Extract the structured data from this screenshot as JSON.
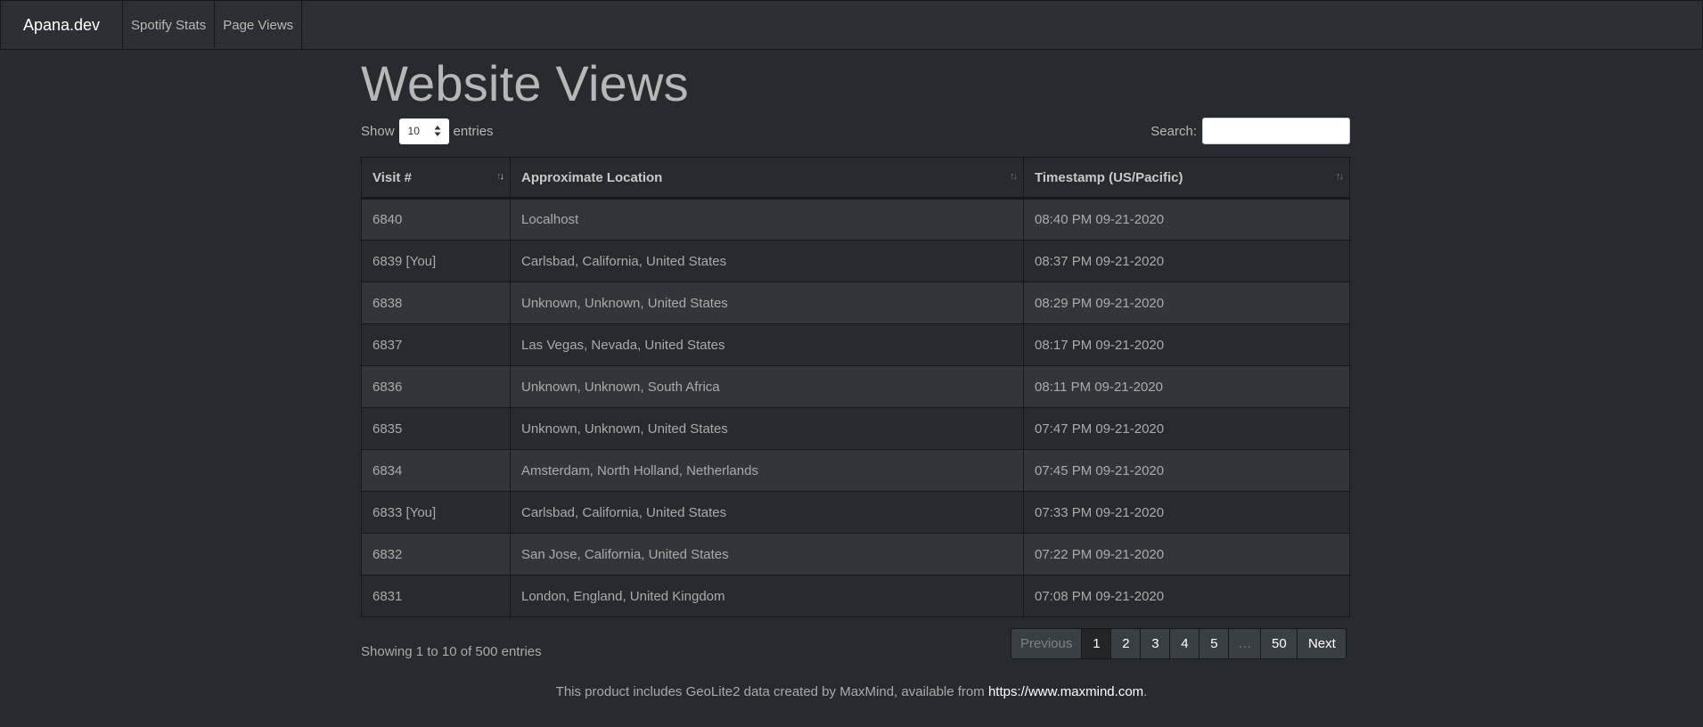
{
  "nav": {
    "brand": "Apana.dev",
    "links": [
      "Spotify Stats",
      "Page Views"
    ]
  },
  "page": {
    "title": "Website Views"
  },
  "length": {
    "show_label": "Show",
    "value": "10",
    "entries_label": "entries"
  },
  "search": {
    "label": "Search:",
    "value": ""
  },
  "table": {
    "columns": [
      "Visit #",
      "Approximate Location",
      "Timestamp (US/Pacific)"
    ],
    "rows": [
      [
        "6840",
        "Localhost",
        "08:40 PM 09-21-2020"
      ],
      [
        "6839 [You]",
        "Carlsbad, California, United States",
        "08:37 PM 09-21-2020"
      ],
      [
        "6838",
        "Unknown, Unknown, United States",
        "08:29 PM 09-21-2020"
      ],
      [
        "6837",
        "Las Vegas, Nevada, United States",
        "08:17 PM 09-21-2020"
      ],
      [
        "6836",
        "Unknown, Unknown, South Africa",
        "08:11 PM 09-21-2020"
      ],
      [
        "6835",
        "Unknown, Unknown, United States",
        "07:47 PM 09-21-2020"
      ],
      [
        "6834",
        "Amsterdam, North Holland, Netherlands",
        "07:45 PM 09-21-2020"
      ],
      [
        "6833 [You]",
        "Carlsbad, California, United States",
        "07:33 PM 09-21-2020"
      ],
      [
        "6832",
        "San Jose, California, United States",
        "07:22 PM 09-21-2020"
      ],
      [
        "6831",
        "London, England, United Kingdom",
        "07:08 PM 09-21-2020"
      ]
    ]
  },
  "info": "Showing 1 to 10 of 500 entries",
  "pagination": {
    "previous": "Previous",
    "pages": [
      "1",
      "2",
      "3",
      "4",
      "5",
      "…",
      "50"
    ],
    "next": "Next",
    "active": "1"
  },
  "footer": {
    "text": "This product includes GeoLite2 data created by MaxMind, available from ",
    "link": "https://www.maxmind.com",
    "trail": "."
  }
}
